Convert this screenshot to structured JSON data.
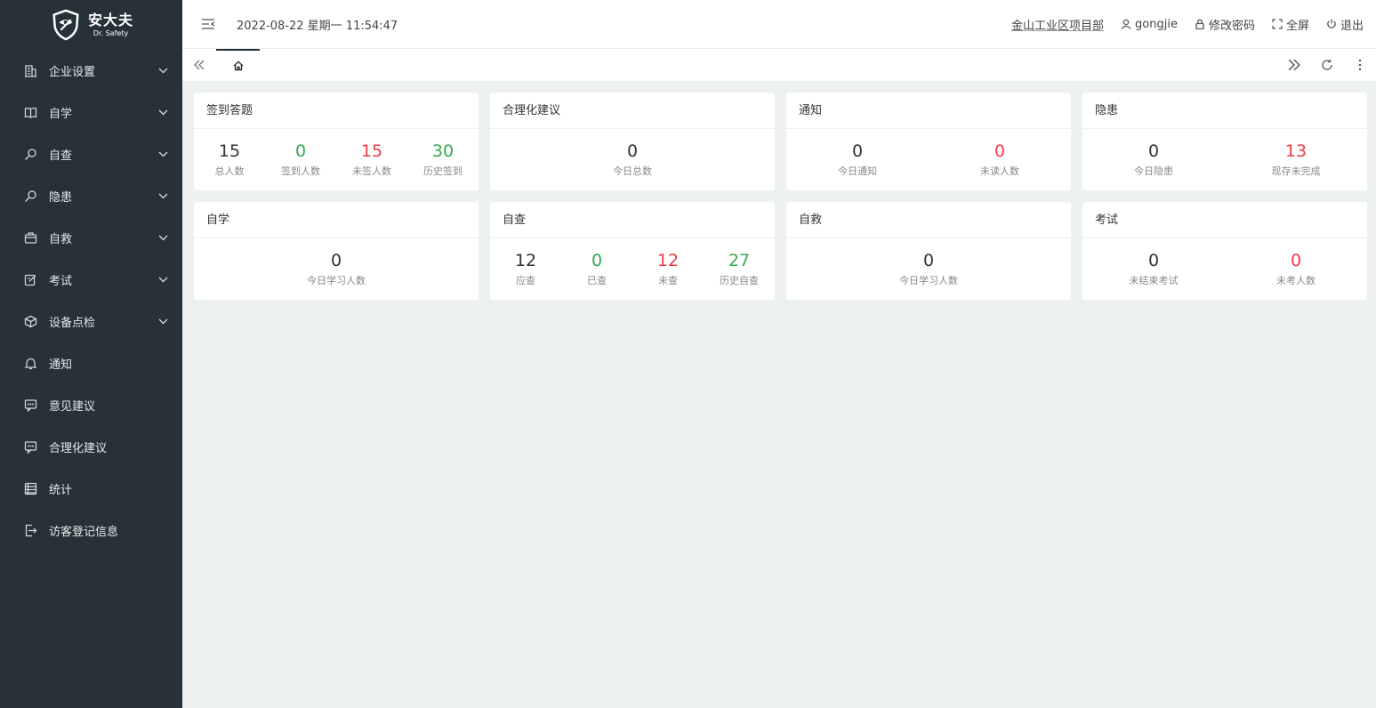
{
  "brand": {
    "name_cn": "安大夫",
    "name_en": "Dr. Safety"
  },
  "sidebar": {
    "items": [
      {
        "label": "企业设置",
        "icon": "building-icon",
        "expandable": true
      },
      {
        "label": "自学",
        "icon": "book-icon",
        "expandable": true
      },
      {
        "label": "自查",
        "icon": "search-icon",
        "expandable": true
      },
      {
        "label": "隐患",
        "icon": "search-icon",
        "expandable": true
      },
      {
        "label": "自救",
        "icon": "kit-icon",
        "expandable": true
      },
      {
        "label": "考试",
        "icon": "edit-icon",
        "expandable": true
      },
      {
        "label": "设备点检",
        "icon": "cube-icon",
        "expandable": true
      },
      {
        "label": "通知",
        "icon": "bell-icon",
        "expandable": false
      },
      {
        "label": "意见建议",
        "icon": "message-icon",
        "expandable": false
      },
      {
        "label": "合理化建议",
        "icon": "message-icon",
        "expandable": false
      },
      {
        "label": "统计",
        "icon": "stats-icon",
        "expandable": false
      },
      {
        "label": "访客登记信息",
        "icon": "visitor-icon",
        "expandable": false
      }
    ]
  },
  "header": {
    "datetime": "2022-08-22 星期一 11:54:47",
    "department": "金山工业区项目部",
    "username": "gongjie",
    "change_password": "修改密码",
    "fullscreen": "全屏",
    "logout": "退出"
  },
  "colors": {
    "sidebar_bg": "#263238",
    "green": "#34a853",
    "red": "#ea3b45",
    "content_bg": "#eef1f2"
  },
  "cards": [
    {
      "title": "签到答题",
      "stats": [
        {
          "value": "15",
          "label": "总人数",
          "color": "default"
        },
        {
          "value": "0",
          "label": "签到人数",
          "color": "green"
        },
        {
          "value": "15",
          "label": "未签人数",
          "color": "red"
        },
        {
          "value": "30",
          "label": "历史签到",
          "color": "green"
        }
      ]
    },
    {
      "title": "合理化建议",
      "stats": [
        {
          "value": "0",
          "label": "今日总数",
          "color": "default"
        }
      ]
    },
    {
      "title": "通知",
      "stats": [
        {
          "value": "0",
          "label": "今日通知",
          "color": "default"
        },
        {
          "value": "0",
          "label": "未读人数",
          "color": "red"
        }
      ]
    },
    {
      "title": "隐患",
      "stats": [
        {
          "value": "0",
          "label": "今日隐患",
          "color": "default"
        },
        {
          "value": "13",
          "label": "现存未完成",
          "color": "red"
        }
      ]
    },
    {
      "title": "自学",
      "stats": [
        {
          "value": "0",
          "label": "今日学习人数",
          "color": "default"
        }
      ]
    },
    {
      "title": "自查",
      "stats": [
        {
          "value": "12",
          "label": "应查",
          "color": "default"
        },
        {
          "value": "0",
          "label": "已查",
          "color": "green"
        },
        {
          "value": "12",
          "label": "未查",
          "color": "red"
        },
        {
          "value": "27",
          "label": "历史自查",
          "color": "green"
        }
      ]
    },
    {
      "title": "自救",
      "stats": [
        {
          "value": "0",
          "label": "今日学习人数",
          "color": "default"
        }
      ]
    },
    {
      "title": "考试",
      "stats": [
        {
          "value": "0",
          "label": "未结束考试",
          "color": "default"
        },
        {
          "value": "0",
          "label": "未考人数",
          "color": "red"
        }
      ]
    }
  ]
}
